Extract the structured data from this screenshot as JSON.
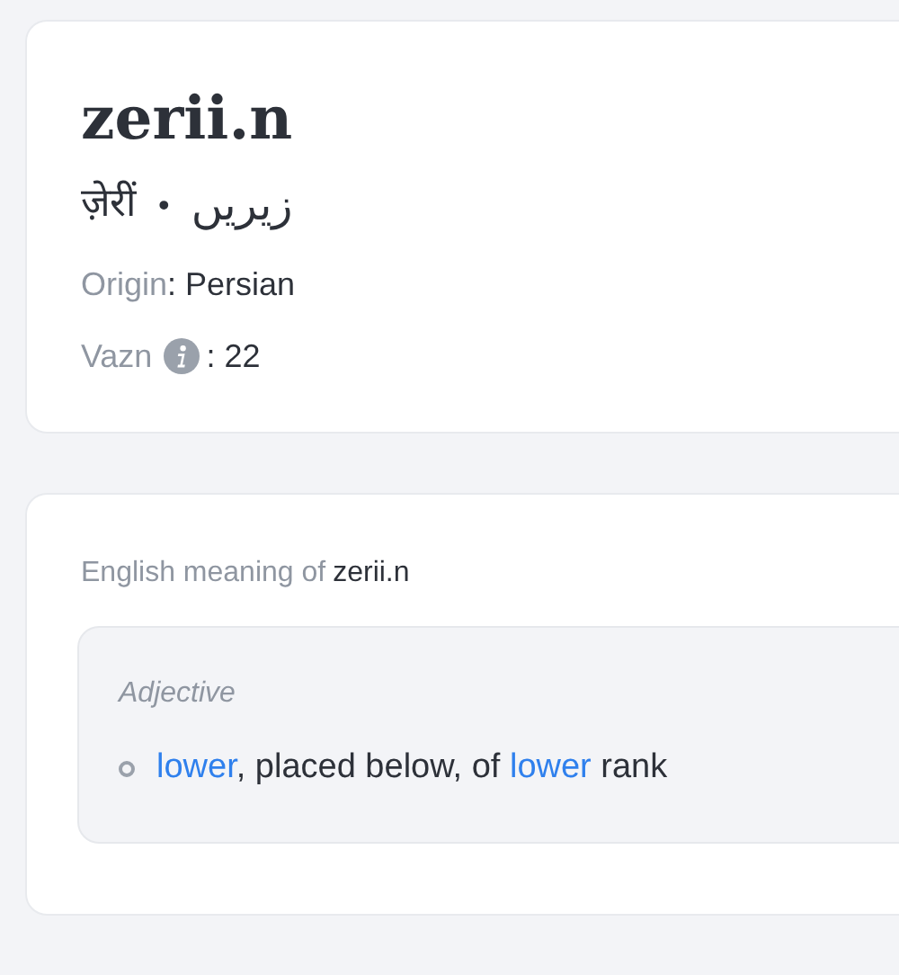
{
  "word": {
    "title": "zerii.n",
    "hindi": "ज़ेरीं",
    "separator": "•",
    "urdu": "زیریں",
    "origin": {
      "label": "Origin",
      "value": ": Persian"
    },
    "vazn": {
      "label": "Vazn",
      "value": ": 22"
    }
  },
  "meaning": {
    "heading_label": "English meaning of",
    "heading_word": "zerii.n",
    "groups": [
      {
        "part_of_speech": "Adjective",
        "senses": [
          [
            {
              "text": "lower",
              "link": true
            },
            {
              "text": ", placed below, of ",
              "link": false
            },
            {
              "text": "lower",
              "link": true
            },
            {
              "text": " rank",
              "link": false
            }
          ]
        ]
      }
    ]
  }
}
